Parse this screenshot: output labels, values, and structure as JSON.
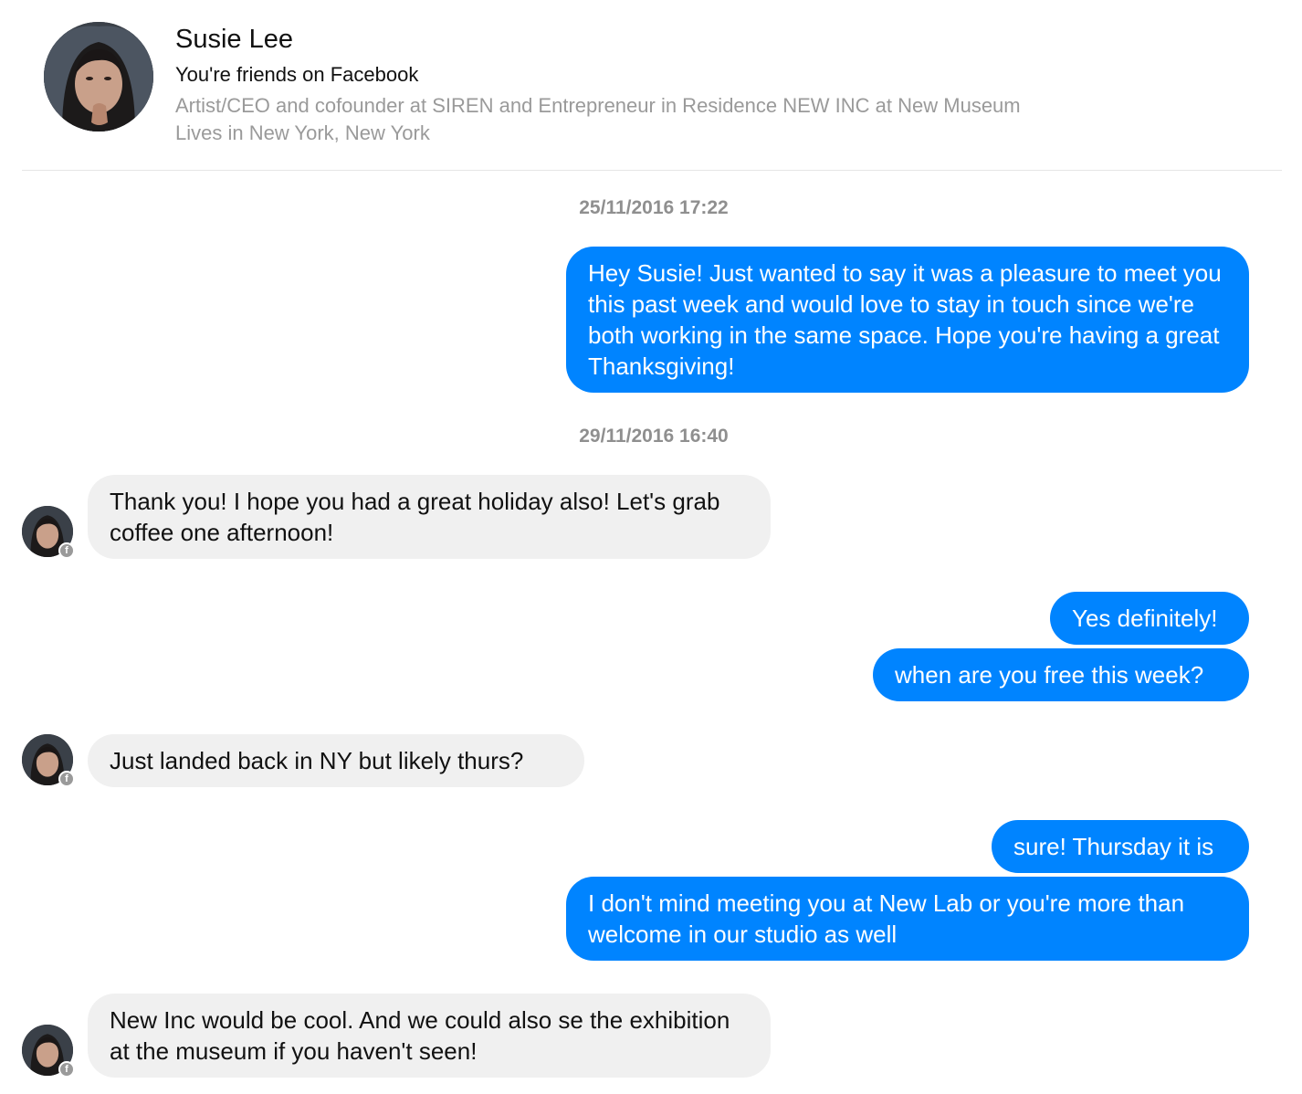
{
  "profile": {
    "name": "Susie Lee",
    "friendship": "You're friends on Facebook",
    "work": "Artist/CEO and cofounder at SIREN and Entrepreneur in Residence NEW INC at New Museum",
    "lives": "Lives in New York, New York"
  },
  "conversation": {
    "timestamps": [
      "25/11/2016 17:22",
      "29/11/2016 16:40"
    ],
    "messages": [
      {
        "sender": "me",
        "text": "Hey Susie! Just wanted to say it was a pleasure to meet you this past week and would love to stay in touch since we're both working in the same space. Hope you're having a great Thanksgiving!"
      },
      {
        "sender": "Susie Lee",
        "text": "Thank you! I hope you had a great holiday also! Let's grab coffee one afternoon!"
      },
      {
        "sender": "me",
        "text": "Yes definitely!"
      },
      {
        "sender": "me",
        "text": "when are you free this week?"
      },
      {
        "sender": "Susie Lee",
        "text": "Just landed back in NY but likely thurs?"
      },
      {
        "sender": "me",
        "text": "sure! Thursday it is"
      },
      {
        "sender": "me",
        "text": "I don't mind meeting you at New Lab or you're more than welcome in our studio as well"
      },
      {
        "sender": "Susie Lee",
        "text": "New Inc would be cool. And we could also se the exhibition at the museum if you haven't seen!"
      }
    ]
  },
  "colors": {
    "outgoing_bubble": "#0084ff",
    "incoming_bubble": "#f0f0f0",
    "timestamp_text": "#8f8f8f",
    "secondary_text": "#9a9a9a"
  },
  "icons": {
    "avatar": "profile-photo",
    "badge": "facebook-badge-icon"
  }
}
